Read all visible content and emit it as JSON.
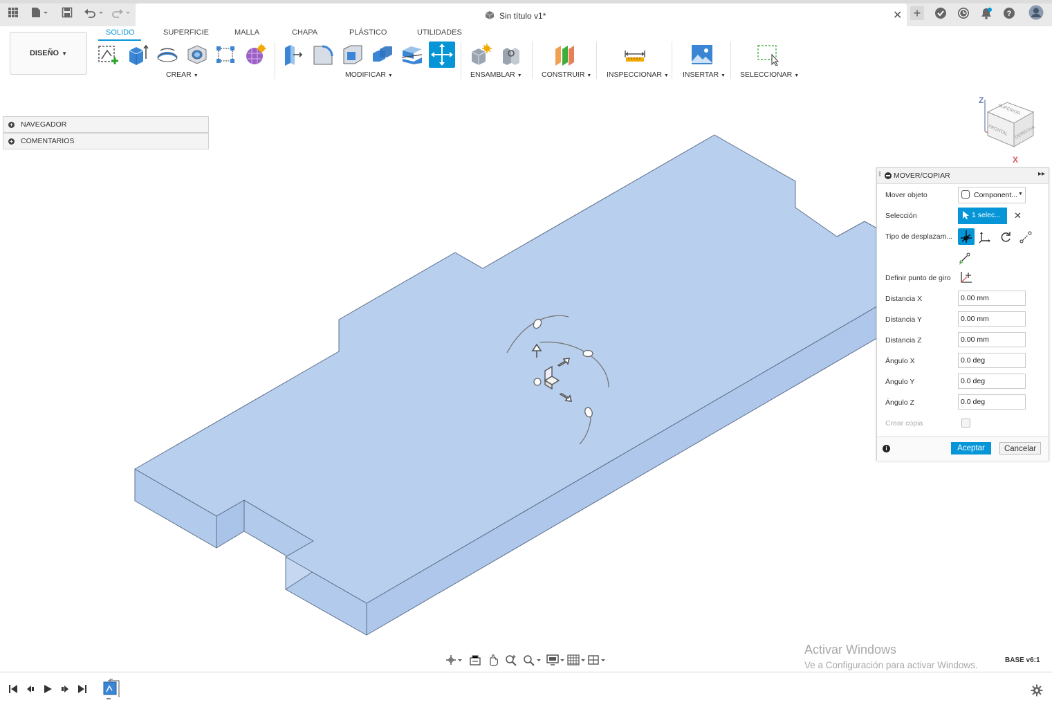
{
  "window": {
    "doc_title": "Sin título v1*"
  },
  "toolbar": {
    "workspace": "DISEÑO",
    "tabs": [
      "SOLIDO",
      "SUPERFICIE",
      "MALLA",
      "CHAPA",
      "PLÁSTICO",
      "UTILIDADES"
    ],
    "groups": {
      "crear": "CREAR",
      "modificar": "MODIFICAR",
      "ensamblar": "ENSAMBLAR",
      "construir": "CONSTRUIR",
      "inspeccionar": "INSPECCIONAR",
      "insertar": "INSERTAR",
      "seleccionar": "SELECCIONAR"
    }
  },
  "browser": {
    "navigator": "NAVEGADOR",
    "comments": "COMENTARIOS"
  },
  "viewcube": {
    "top": "SUPERIOR",
    "front": "FRONTAL",
    "right": "DERECHA",
    "axis_z": "Z",
    "axis_x": "X"
  },
  "dialog": {
    "title": "MOVER/COPIAR",
    "move_object_label": "Mover objeto",
    "move_object_value": "Component...",
    "selection_label": "Selección",
    "selection_value": "1 selec...",
    "move_type_label": "Tipo de desplazam...",
    "pivot_label": "Definir punto de giro",
    "dist_x_label": "Distancia X",
    "dist_x": "0.00 mm",
    "dist_y_label": "Distancia Y",
    "dist_y": "0.00 mm",
    "dist_z_label": "Distancia Z",
    "dist_z": "0.00 mm",
    "ang_x_label": "Ángulo X",
    "ang_x": "0.0 deg",
    "ang_y_label": "Ángulo Y",
    "ang_y": "0.0 deg",
    "ang_z_label": "Ángulo Z",
    "ang_z": "0.0 deg",
    "create_copy_label": "Crear copia",
    "ok": "Aceptar",
    "cancel": "Cancelar"
  },
  "watermark": {
    "title": "Activar Windows",
    "subtitle": "Ve a Configuración para activar Windows."
  },
  "component_label": "BASE v6:1",
  "colors": {
    "accent": "#0696d7",
    "body_fill": "#b5cded",
    "body_edge": "#5c6f8a"
  }
}
